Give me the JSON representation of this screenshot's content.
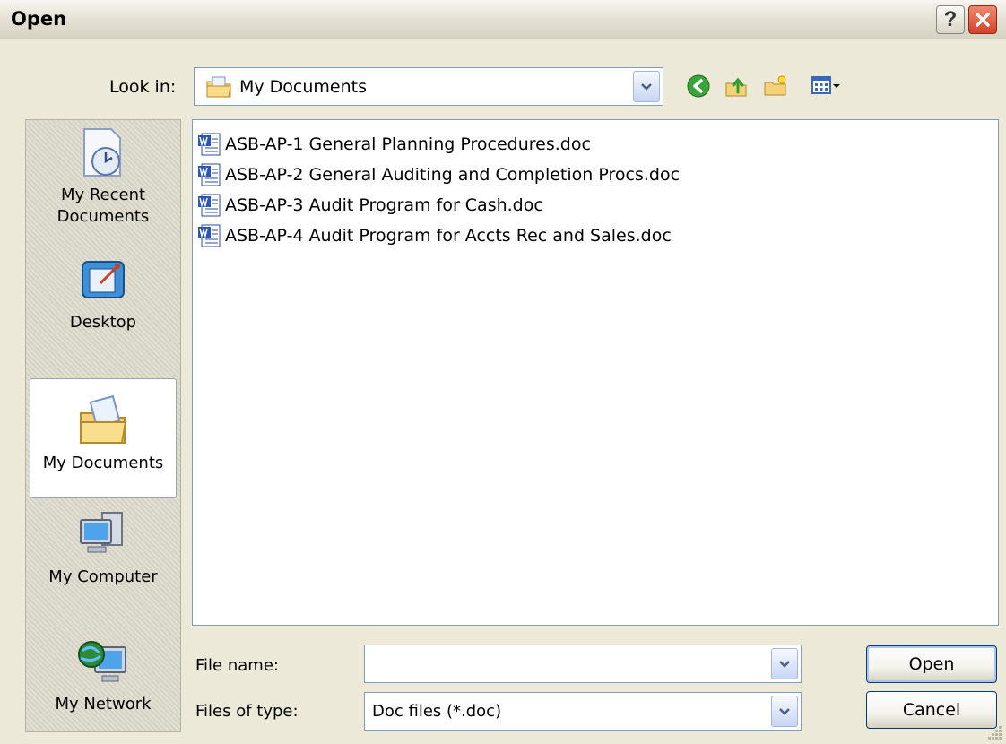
{
  "window": {
    "title": "Open"
  },
  "lookin": {
    "label": "Look in:",
    "value": "My Documents"
  },
  "places": [
    {
      "label": "My Recent Documents"
    },
    {
      "label": "Desktop"
    },
    {
      "label": "My Documents"
    },
    {
      "label": "My Computer"
    },
    {
      "label": "My Network"
    }
  ],
  "files": [
    "ASB-AP-1 General Planning Procedures.doc",
    "ASB-AP-2 General Auditing and Completion Procs.doc",
    "ASB-AP-3 Audit Program for Cash.doc",
    "ASB-AP-4 Audit Program for Accts Rec and Sales.doc"
  ],
  "filename": {
    "label": "File name:",
    "value": ""
  },
  "filetype": {
    "label": "Files of type:",
    "value": "Doc files (*.doc)"
  },
  "buttons": {
    "open": "Open",
    "cancel": "Cancel"
  },
  "colors": {
    "dialog_bg": "#ece9d8",
    "border": "#7f9db9",
    "close": "#d2422a"
  }
}
